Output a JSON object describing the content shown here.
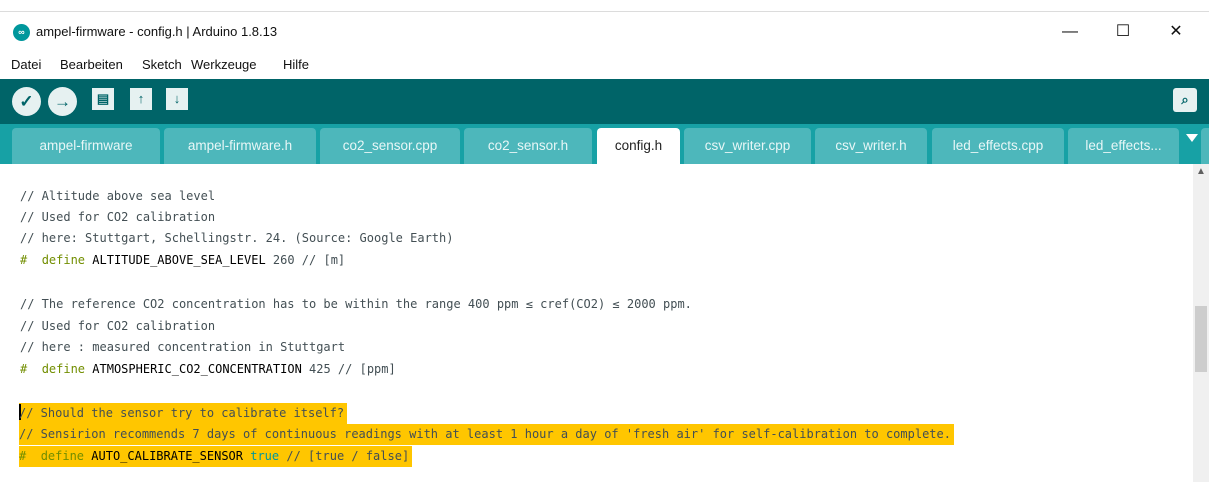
{
  "window": {
    "title": "ampel-firmware - config.h | Arduino 1.8.13",
    "app_icon_glyph": "∞",
    "controls": {
      "minimize": "—",
      "maximize": "☐",
      "close": "✕"
    }
  },
  "menu": [
    "Datei",
    "Bearbeiten",
    "Sketch",
    "Werkzeuge",
    "Hilfe"
  ],
  "toolbar": {
    "verify_icon": "✓",
    "upload_icon": "→",
    "new_icon": "▤",
    "open_icon": "↑",
    "save_icon": "↓",
    "serial_monitor_icon": "⌕"
  },
  "tabs": [
    {
      "label": "ampel-firmware",
      "active": false
    },
    {
      "label": "ampel-firmware.h",
      "active": false
    },
    {
      "label": "co2_sensor.cpp",
      "active": false
    },
    {
      "label": "co2_sensor.h",
      "active": false
    },
    {
      "label": "config.h",
      "active": true
    },
    {
      "label": "csv_writer.cpp",
      "active": false
    },
    {
      "label": "csv_writer.h",
      "active": false
    },
    {
      "label": "led_effects.cpp",
      "active": false
    },
    {
      "label": "led_effects...",
      "active": false
    }
  ],
  "code": {
    "line1": "// Altitude above sea level",
    "line2": "// Used for CO2 calibration",
    "line3": "// here: Stuttgart, Schellingstr. 24. (Source: Google Earth)",
    "line4": {
      "hash": "#",
      "kw": "define",
      "name": "ALTITUDE_ABOVE_SEA_LEVEL",
      "rest": " 260 // [m]"
    },
    "line5": "// The reference CO2 concentration has to be within the range 400 ppm ≤ cref(CO2) ≤ 2000 ppm.",
    "line6": "// Used for CO2 calibration",
    "line7": "// here : measured concentration in Stuttgart",
    "line8": {
      "hash": "#",
      "kw": "define",
      "name": "ATMOSPHERIC_CO2_CONCENTRATION",
      "rest": " 425 // [ppm]"
    },
    "line9": "// Should the sensor try to calibrate itself?",
    "line10": "// Sensirion recommends 7 days of continuous readings with at least 1 hour a day of 'fresh air' for self-calibration to complete.",
    "line11": {
      "hash": "#",
      "kw": "define",
      "name": "AUTO_CALIBRATE_SENSOR",
      "value": "true",
      "rest": " // [true / false]"
    }
  },
  "colors": {
    "toolbar_bg": "#006468",
    "tabbar_bg": "#17a1a5",
    "tab_bg": "#4db7bb",
    "highlight": "#ffc600",
    "keyword": "#728e00"
  }
}
